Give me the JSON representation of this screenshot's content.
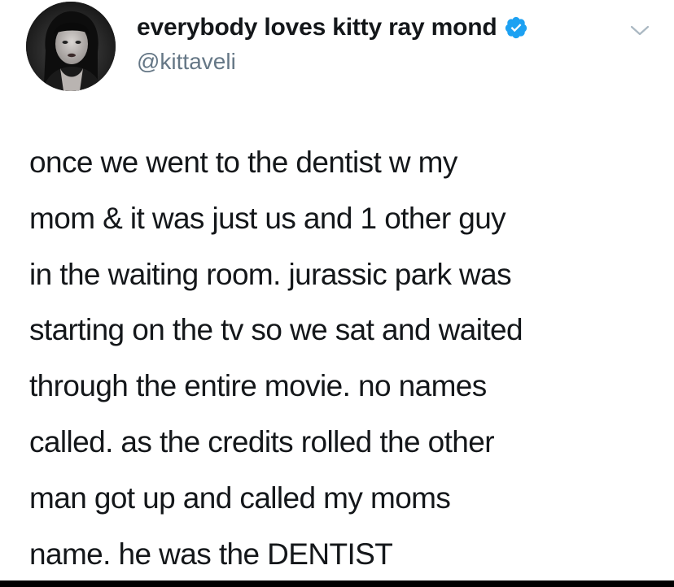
{
  "tweet": {
    "author": {
      "display_name": "everybody loves kitty ray mond",
      "handle": "@kittaveli",
      "verified": true,
      "verified_icon": "verified-badge-icon",
      "avatar": "profile-avatar"
    },
    "menu_icon": "chevron-down-icon",
    "text_lines": [
      "once we went to the dentist w my",
      "mom & it was just us and 1 other guy",
      "in the waiting room. jurassic park was",
      "starting on the tv so we sat and waited",
      "through the entire movie. no names",
      "called. as the credits rolled the other",
      "man got up and called my moms",
      "name. he was the DENTIST"
    ]
  },
  "colors": {
    "text": "#14171a",
    "handle": "#657786",
    "verified": "#1da1f2",
    "chevron": "#aab8c2",
    "background": "#ffffff",
    "bottom_bar": "#000000"
  }
}
